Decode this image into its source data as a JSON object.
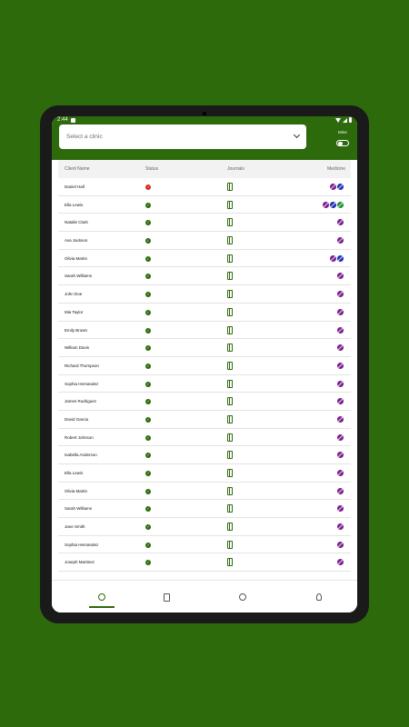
{
  "statusbar": {
    "time": "2:44"
  },
  "header": {
    "clinic_placeholder": "Select a clinic",
    "mine_label": "Mine"
  },
  "table": {
    "columns": {
      "name": "Client Name",
      "status": "Status",
      "journals": "Journals",
      "medicine": "Medicine"
    },
    "rows": [
      {
        "name": "Daniel Hall",
        "status": "error",
        "meds": [
          "purple",
          "blue"
        ]
      },
      {
        "name": "Ella Lewis",
        "status": "ok",
        "meds": [
          "purple",
          "blue",
          "green"
        ]
      },
      {
        "name": "Natalie Clark",
        "status": "ok",
        "meds": [
          "purple"
        ]
      },
      {
        "name": "Ava Jackson",
        "status": "ok",
        "meds": [
          "purple"
        ]
      },
      {
        "name": "Olivia Martin",
        "status": "ok",
        "meds": [
          "purple",
          "blue"
        ]
      },
      {
        "name": "Sarah Williams",
        "status": "ok",
        "meds": [
          "purple"
        ]
      },
      {
        "name": "John Doe",
        "status": "ok",
        "meds": [
          "purple"
        ]
      },
      {
        "name": "Mia Taylor",
        "status": "ok",
        "meds": [
          "purple"
        ]
      },
      {
        "name": "Emily Brown",
        "status": "ok",
        "meds": [
          "purple"
        ]
      },
      {
        "name": "William Davis",
        "status": "ok",
        "meds": [
          "purple"
        ]
      },
      {
        "name": "Richard Thompson",
        "status": "ok",
        "meds": [
          "purple"
        ]
      },
      {
        "name": "Sophia Hernandez",
        "status": "ok",
        "meds": [
          "purple"
        ]
      },
      {
        "name": "James Rodriguez",
        "status": "ok",
        "meds": [
          "purple"
        ]
      },
      {
        "name": "David Garcia",
        "status": "ok",
        "meds": [
          "purple"
        ]
      },
      {
        "name": "Robert Johnson",
        "status": "ok",
        "meds": [
          "purple"
        ]
      },
      {
        "name": "Isabella Anderson",
        "status": "ok",
        "meds": [
          "purple"
        ]
      },
      {
        "name": "Ella Lewis",
        "status": "ok",
        "meds": [
          "purple"
        ]
      },
      {
        "name": "Olivia Martin",
        "status": "ok",
        "meds": [
          "purple"
        ]
      },
      {
        "name": "Sarah Williams",
        "status": "ok",
        "meds": [
          "purple"
        ]
      },
      {
        "name": "Jane Smith",
        "status": "ok",
        "meds": [
          "purple"
        ]
      },
      {
        "name": "Sophia Hernandez",
        "status": "ok",
        "meds": [
          "purple"
        ]
      },
      {
        "name": "Joseph Martinez",
        "status": "ok",
        "meds": [
          "purple"
        ]
      }
    ]
  },
  "status_glyphs": {
    "ok": "✓",
    "error": "!"
  },
  "colors": {
    "brand": "#2d6a0c",
    "error": "#d62c20",
    "pill_purple": "#7a1f8f",
    "pill_blue": "#1f2fb5",
    "pill_green": "#1e8f3a"
  },
  "bottomnav": {
    "items": [
      {
        "icon": "home-icon",
        "active": true
      },
      {
        "icon": "journal-icon",
        "active": false
      },
      {
        "icon": "clock-icon",
        "active": false
      },
      {
        "icon": "profile-icon",
        "active": false
      }
    ]
  }
}
